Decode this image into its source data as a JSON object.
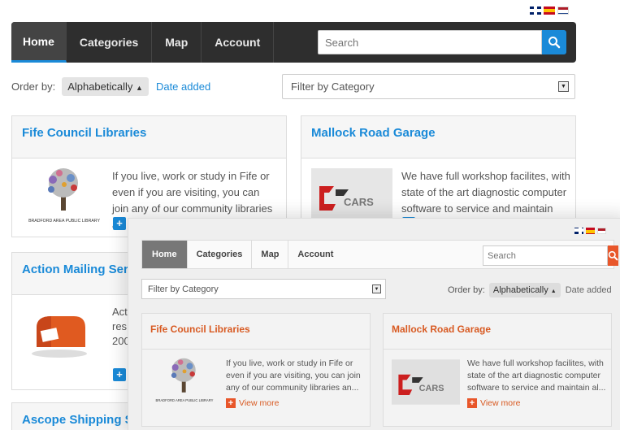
{
  "flags": [
    {
      "name": "uk-flag-icon"
    },
    {
      "name": "spain-flag-icon"
    },
    {
      "name": "netherlands-flag-icon"
    }
  ],
  "navbar": {
    "items": [
      "Home",
      "Categories",
      "Map",
      "Account"
    ],
    "search_placeholder": "Search",
    "accent": "#1a8ad8"
  },
  "order": {
    "label": "Order by:",
    "alphabetically": "Alphabetically",
    "date_added": "Date added"
  },
  "filter": {
    "placeholder": "Filter by Category"
  },
  "listings": [
    {
      "title": "Fife Council Libraries",
      "description": "If you live, work or study in Fife or even if you are visiting, you can join any of our community libraries an...",
      "thumbnail": "bradford-library-tree-logo",
      "thumbnail_caption": "BRADFORD AREA PUBLIC LIBRARY"
    },
    {
      "title": "Mallock Road Garage",
      "description": "We have full workshop facilites, with state of the art diagnostic computer software to service and maintain al...",
      "thumbnail": "cars-logo"
    },
    {
      "title": "Action Mailing Ser",
      "description": "Act res US 200",
      "thumbnail": "red-mailbox"
    },
    {
      "title": "Ascope Shipping S"
    }
  ],
  "overlay": {
    "navbar": {
      "items": [
        "Home",
        "Categories",
        "Map",
        "Account"
      ],
      "search_placeholder": "Search",
      "accent": "#e8562a"
    },
    "filter_placeholder": "Filter by Category",
    "order": {
      "label": "Order by:",
      "alphabetically": "Alphabetically",
      "date_added": "Date added"
    },
    "listings": [
      {
        "title": "Fife Council Libraries",
        "description": "If you live, work or study in Fife or even if you are visiting, you can join any of our community libraries an...",
        "view_more": "View more",
        "thumbnail_caption": "BRADFORD AREA PUBLIC LIBRARY"
      },
      {
        "title": "Mallock Road Garage",
        "description": "We have full workshop facilites, with state of the art diagnostic computer software to service and maintain al...",
        "view_more": "View more"
      }
    ]
  }
}
